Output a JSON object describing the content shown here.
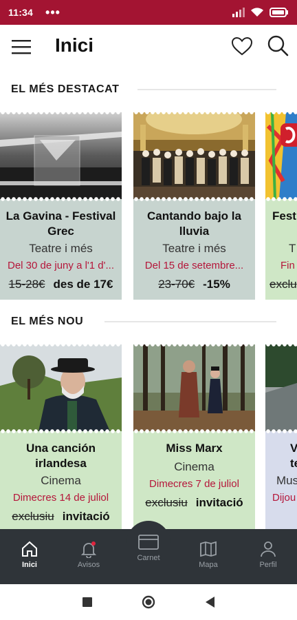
{
  "statusbar": {
    "time": "11:34",
    "dots": "•••"
  },
  "header": {
    "title": "Inici"
  },
  "sections": [
    {
      "title": "EL MÉS DESTACAT",
      "cards": [
        {
          "title": "La Gavina - Festival Grec",
          "category": "Teatre i més",
          "date": "Del 30 de juny a l'1 d'...",
          "old_price": "15-28€",
          "new_price": "des de 17€",
          "color": "#c7d4cf"
        },
        {
          "title": "Cantando bajo la lluvia",
          "category": "Teatre i més",
          "date": "Del 15 de setembre...",
          "old_price": "23-70€",
          "new_price": "-15%",
          "color": "#c7d4cf"
        },
        {
          "title": "Fest",
          "category": "T",
          "date": "Fin",
          "old_price": "exclu",
          "new_price": "",
          "color": "#cfe7c6"
        }
      ]
    },
    {
      "title": "EL MÉS NOU",
      "cards": [
        {
          "title": "Una canción irlandesa",
          "category": "Cinema",
          "date": "Dimecres 14 de juliol",
          "old_price": "exclusiu",
          "new_price": "invitació",
          "color": "#cfe7c6"
        },
        {
          "title": "Miss Marx",
          "category": "Cinema",
          "date": "Dimecres 7 de juliol",
          "old_price": "exclusiu",
          "new_price": "invitació",
          "color": "#cfe7c6"
        },
        {
          "title": "V terra",
          "category": "Mus",
          "date": "Dijou",
          "old_price": "",
          "new_price": "",
          "color": "#d7dcec"
        }
      ]
    }
  ],
  "bottom_nav": [
    {
      "label": "Inici",
      "icon": "home-icon",
      "active": true
    },
    {
      "label": "Avisos",
      "icon": "bell-icon",
      "active": false
    },
    {
      "label": "Carnet",
      "icon": "card-icon",
      "active": false
    },
    {
      "label": "Mapa",
      "icon": "map-icon",
      "active": false
    },
    {
      "label": "Perfil",
      "icon": "user-icon",
      "active": false
    }
  ]
}
